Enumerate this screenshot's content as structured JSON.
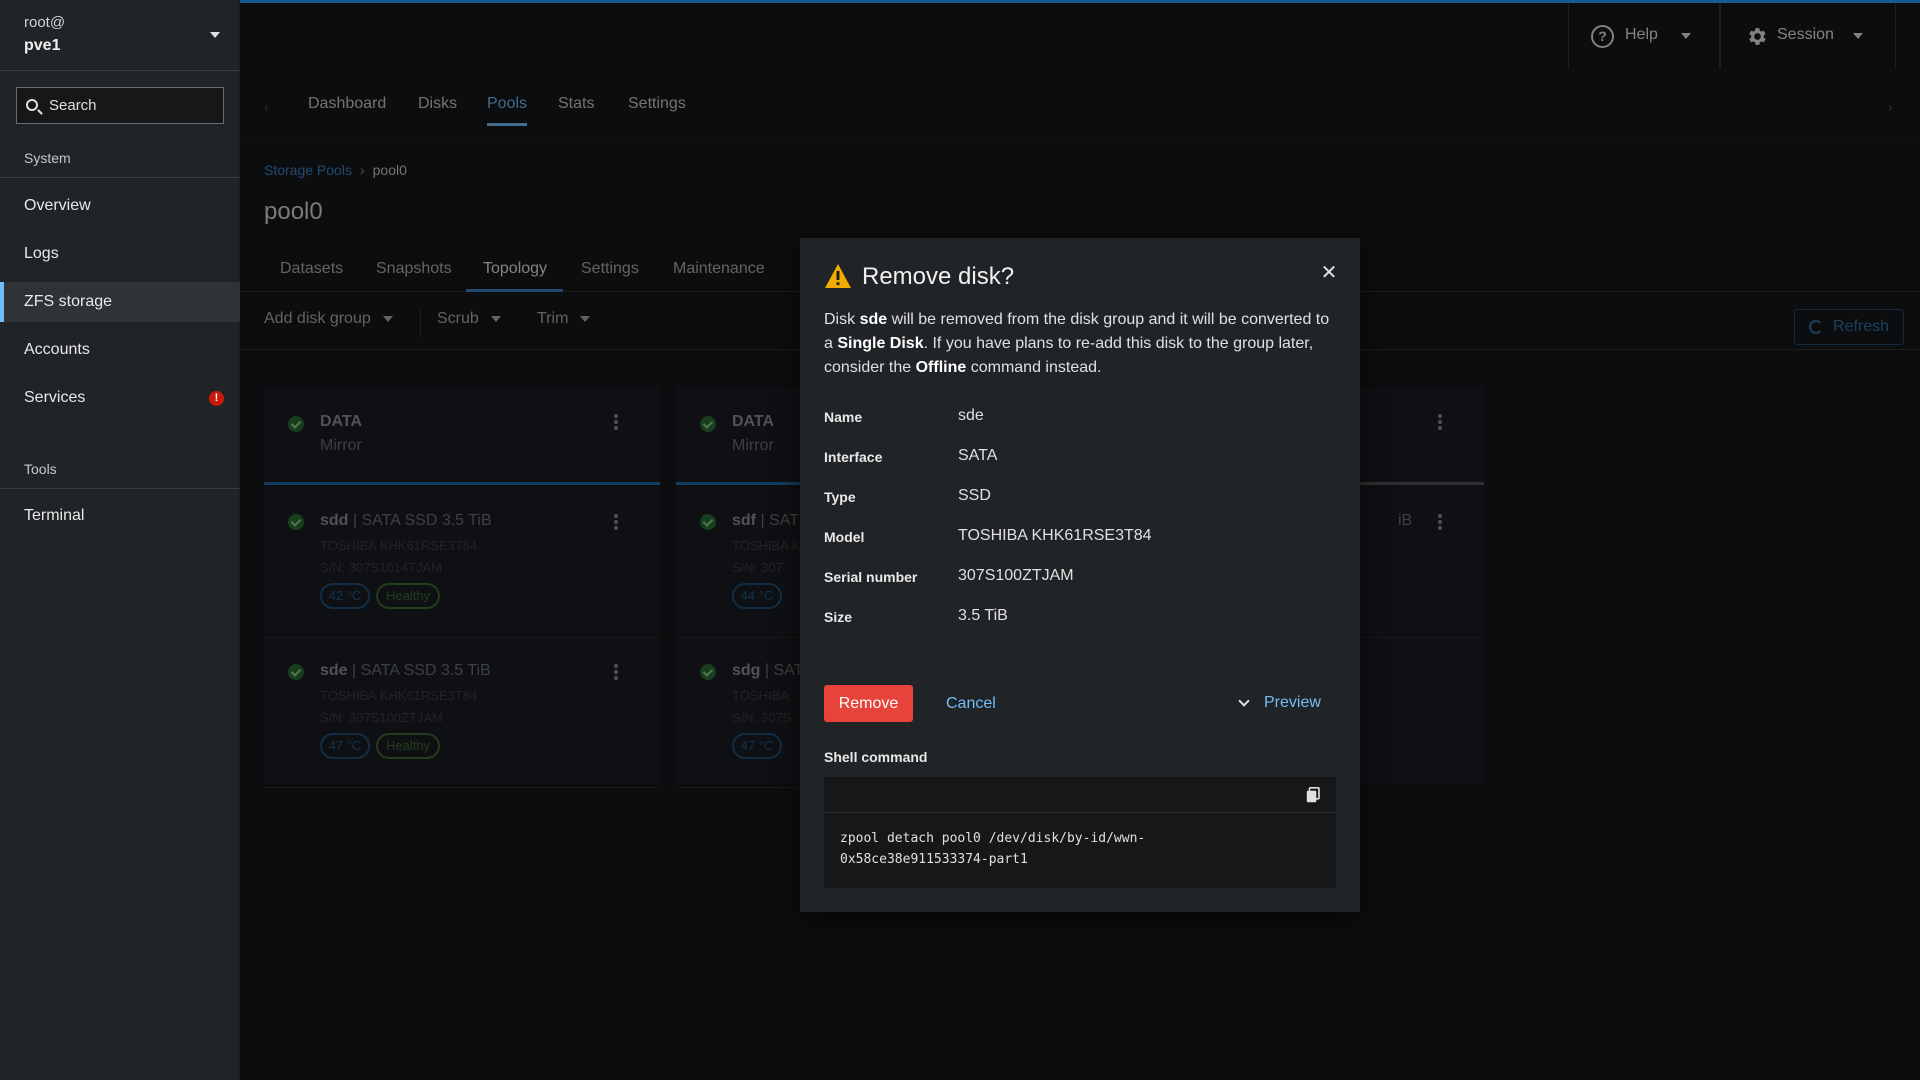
{
  "sidebar": {
    "host_user": "root@",
    "host_name": "pve1",
    "search_placeholder": "Search",
    "groups": {
      "system": "System",
      "tools": "Tools"
    },
    "items": {
      "overview": "Overview",
      "logs": "Logs",
      "zfs": "ZFS storage",
      "accounts": "Accounts",
      "services": "Services",
      "terminal": "Terminal"
    },
    "services_alert": "!"
  },
  "topbar": {
    "help": "Help",
    "session": "Session"
  },
  "nav_tabs": [
    "Dashboard",
    "Disks",
    "Pools",
    "Stats",
    "Settings"
  ],
  "breadcrumb": {
    "parent": "Storage Pools",
    "current": "pool0"
  },
  "page_title": "pool0",
  "sub_tabs": [
    "Datasets",
    "Snapshots",
    "Topology",
    "Settings",
    "Maintenance"
  ],
  "toolbar": {
    "add_disk_group": "Add disk group",
    "scrub": "Scrub",
    "trim": "Trim",
    "refresh": "Refresh"
  },
  "cards": [
    {
      "title": "DATA",
      "layout": "Mirror",
      "disks": [
        {
          "name": "sdd",
          "info": " | SATA SSD 3.5 TiB",
          "model": "TOSHIBA KHK61RSE3T84",
          "sn": "S/N: 307S1014TJAM",
          "temp": "42 °C",
          "health": "Healthy"
        },
        {
          "name": "sde",
          "info": " | SATA SSD 3.5 TiB",
          "model": "TOSHIBA KHK61RSE3T84",
          "sn": "S/N: 307S100ZTJAM",
          "temp": "47 °C",
          "health": "Healthy"
        }
      ]
    },
    {
      "title": "DATA",
      "layout": "Mirror",
      "disks": [
        {
          "name": "sdf",
          "info": " | SAT",
          "model": "TOSHIBA K",
          "sn": "S/N: 307",
          "temp": "44 °C"
        },
        {
          "name": "sdg",
          "info": " | SAT",
          "model": "TOSHIBA",
          "sn": "S/N: 307S",
          "temp": "47 °C"
        }
      ]
    },
    {
      "partial_text": "iB"
    }
  ],
  "modal": {
    "title": "Remove disk?",
    "desc": {
      "p1": "Disk ",
      "disk": "sde",
      "p2": " will be removed from the disk group and it will be converted to a ",
      "single": "Single Disk",
      "p3": ". If you have plans to re-add this disk to the group later, consider the ",
      "offline": "Offline",
      "p4": " command instead."
    },
    "props": [
      {
        "label": "Name",
        "value": "sde"
      },
      {
        "label": "Interface",
        "value": "SATA"
      },
      {
        "label": "Type",
        "value": "SSD"
      },
      {
        "label": "Model",
        "value": "TOSHIBA KHK61RSE3T84"
      },
      {
        "label": "Serial number",
        "value": "307S100ZTJAM"
      },
      {
        "label": "Size",
        "value": "3.5 TiB"
      }
    ],
    "remove": "Remove",
    "cancel": "Cancel",
    "preview": "Preview",
    "shell_label": "Shell command",
    "shell_command": "zpool detach pool0 /dev/disk/by-id/wwn-\n0x58ce38e911533374-part1"
  },
  "colors": {
    "accent": "#73bcf7",
    "danger": "#e8433a",
    "topline": "#2b9af3",
    "warning": "#f0ab00"
  }
}
